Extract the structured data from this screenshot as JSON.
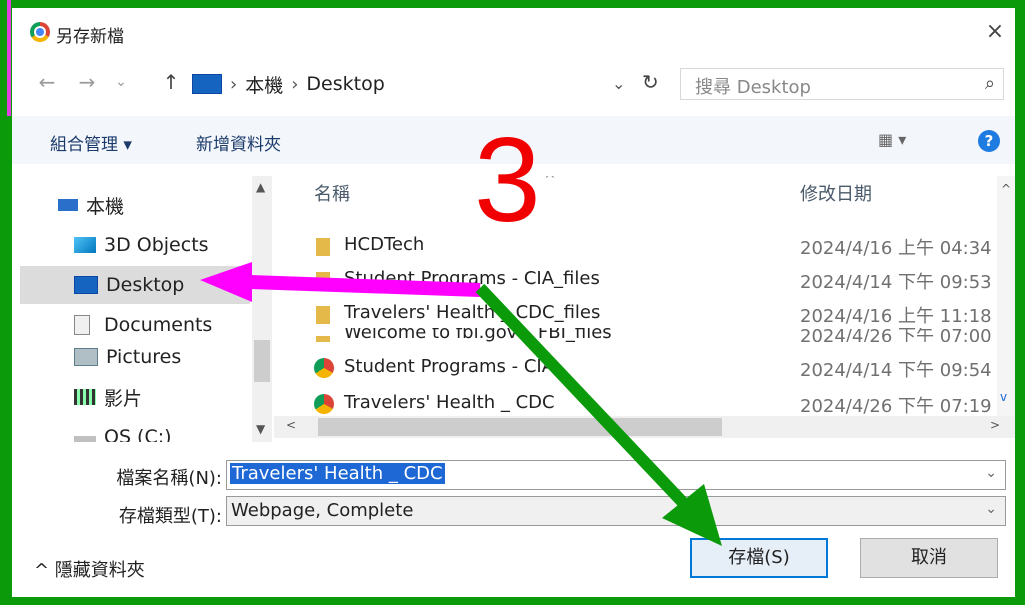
{
  "window": {
    "title": "另存新檔",
    "close_glyph": "×"
  },
  "nav": {
    "back": "←",
    "forward": "→",
    "recent": "⌄",
    "up": "↑",
    "breadcrumb": [
      "本機",
      "Desktop"
    ],
    "separator": "›",
    "dropdown": "⌄",
    "refresh": "↻",
    "search_placeholder": "搜尋 Desktop",
    "search_icon": "⌕"
  },
  "toolbar": {
    "organize": "組合管理 ▾",
    "new_folder": "新增資料夾",
    "view": "▦ ▾",
    "help": "?"
  },
  "sidebar": {
    "items": [
      {
        "label": "本機",
        "icon": "computer-icon"
      },
      {
        "label": "3D Objects",
        "icon": "cube-icon"
      },
      {
        "label": "Desktop",
        "icon": "desktop-icon",
        "selected": true
      },
      {
        "label": "Documents",
        "icon": "document-icon"
      },
      {
        "label": "Pictures",
        "icon": "picture-icon"
      },
      {
        "label": "影片",
        "icon": "video-icon"
      },
      {
        "label": "OS (C:)",
        "icon": "drive-icon"
      }
    ]
  },
  "file_list": {
    "columns": {
      "name": "名稱",
      "date": "修改日期"
    },
    "sort_indicator": "^",
    "rows": [
      {
        "name": "HCDTech",
        "date": "2024/4/16 上午 04:34",
        "type": "folder"
      },
      {
        "name": "Student Programs - CIA_files",
        "date": "2024/4/14 下午 09:53",
        "type": "folder"
      },
      {
        "name": "Travelers' Health _ CDC_files",
        "date": "2024/4/16 上午 11:18",
        "type": "folder"
      },
      {
        "name": "Welcome to fbi.gov _ FBI_files",
        "date": "2024/4/26 下午 07:00",
        "type": "folder"
      },
      {
        "name": "Student Programs - CIA",
        "date": "2024/4/14 下午 09:54",
        "type": "chrome"
      },
      {
        "name": "Travelers' Health _ CDC",
        "date": "2024/4/26 下午 07:19",
        "type": "chrome"
      }
    ]
  },
  "form": {
    "filename_label": "檔案名稱(N):",
    "filename_value": "Travelers' Health _ CDC",
    "filetype_label": "存檔類型(T):",
    "filetype_value": "Webpage, Complete"
  },
  "footer": {
    "hide_folders": "^ 隱藏資料夾",
    "save": "存檔(S)",
    "cancel": "取消"
  },
  "annotations": {
    "step_number": "3",
    "pink_arrow_color": "#ff00ff",
    "green_arrow_color": "#0a9a0a",
    "number_color": "#f00000"
  }
}
